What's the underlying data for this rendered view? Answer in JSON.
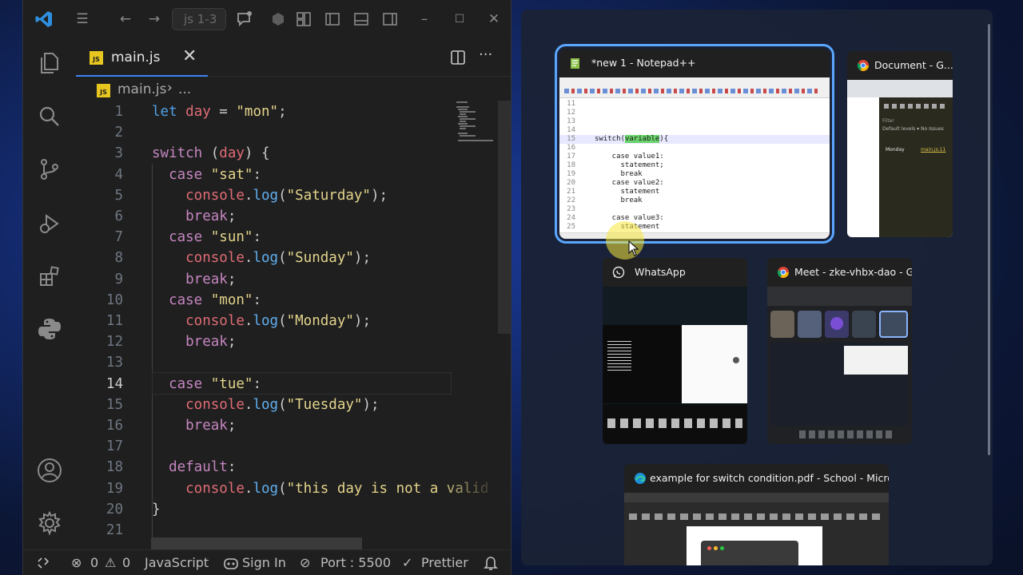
{
  "vscode": {
    "search_text": "js 1-3",
    "tab": {
      "label": "main.js",
      "badge": "JS"
    },
    "breadcrumb": {
      "file": "main.js",
      "more": "..."
    },
    "editor": {
      "active_line": 14,
      "lines": [
        {
          "n": "1",
          "tokens": [
            [
              "kw2",
              "let "
            ],
            [
              "var",
              "day"
            ],
            [
              "plain",
              " = "
            ],
            [
              "str",
              "\"mon\""
            ],
            [
              "plain",
              ";"
            ]
          ]
        },
        {
          "n": "2",
          "tokens": []
        },
        {
          "n": "3",
          "tokens": [
            [
              "kw",
              "switch"
            ],
            [
              "plain",
              " ("
            ],
            [
              "var",
              "day"
            ],
            [
              "plain",
              ") {"
            ]
          ]
        },
        {
          "n": "4",
          "tokens": [
            [
              "kw",
              "  case "
            ],
            [
              "str",
              "\"sat\""
            ],
            [
              "plain",
              ":"
            ]
          ]
        },
        {
          "n": "5",
          "tokens": [
            [
              "var",
              "    console"
            ],
            [
              "plain",
              "."
            ],
            [
              "fn",
              "log"
            ],
            [
              "plain",
              "("
            ],
            [
              "str",
              "\"Saturday\""
            ],
            [
              "plain",
              ");"
            ]
          ]
        },
        {
          "n": "6",
          "tokens": [
            [
              "kw",
              "    break"
            ],
            [
              "plain",
              ";"
            ]
          ]
        },
        {
          "n": "7",
          "tokens": [
            [
              "kw",
              "  case "
            ],
            [
              "str",
              "\"sun\""
            ],
            [
              "plain",
              ":"
            ]
          ]
        },
        {
          "n": "8",
          "tokens": [
            [
              "var",
              "    console"
            ],
            [
              "plain",
              "."
            ],
            [
              "fn",
              "log"
            ],
            [
              "plain",
              "("
            ],
            [
              "str",
              "\"Sunday\""
            ],
            [
              "plain",
              ");"
            ]
          ]
        },
        {
          "n": "9",
          "tokens": [
            [
              "kw",
              "    break"
            ],
            [
              "plain",
              ";"
            ]
          ]
        },
        {
          "n": "10",
          "tokens": [
            [
              "kw",
              "  case "
            ],
            [
              "str",
              "\"mon\""
            ],
            [
              "plain",
              ":"
            ]
          ]
        },
        {
          "n": "11",
          "tokens": [
            [
              "var",
              "    console"
            ],
            [
              "plain",
              "."
            ],
            [
              "fn",
              "log"
            ],
            [
              "plain",
              "("
            ],
            [
              "str",
              "\"Monday\""
            ],
            [
              "plain",
              ");"
            ]
          ]
        },
        {
          "n": "12",
          "tokens": [
            [
              "kw",
              "    break"
            ],
            [
              "plain",
              ";"
            ]
          ]
        },
        {
          "n": "13",
          "tokens": []
        },
        {
          "n": "14",
          "tokens": [
            [
              "kw",
              "  case "
            ],
            [
              "str",
              "\"tue\""
            ],
            [
              "plain",
              ":"
            ]
          ]
        },
        {
          "n": "15",
          "tokens": [
            [
              "var",
              "    console"
            ],
            [
              "plain",
              "."
            ],
            [
              "fn",
              "log"
            ],
            [
              "plain",
              "("
            ],
            [
              "str",
              "\"Tuesday\""
            ],
            [
              "plain",
              ");"
            ]
          ]
        },
        {
          "n": "16",
          "tokens": [
            [
              "kw",
              "    break"
            ],
            [
              "plain",
              ";"
            ]
          ]
        },
        {
          "n": "17",
          "tokens": []
        },
        {
          "n": "18",
          "tokens": [
            [
              "kw",
              "  default"
            ],
            [
              "plain",
              ":"
            ]
          ]
        },
        {
          "n": "19",
          "tokens": [
            [
              "var",
              "    console"
            ],
            [
              "plain",
              "."
            ],
            [
              "fn",
              "log"
            ],
            [
              "plain",
              "("
            ],
            [
              "str",
              "\"this day is not a valid"
            ]
          ]
        },
        {
          "n": "20",
          "tokens": [
            [
              "plain",
              "}"
            ]
          ]
        },
        {
          "n": "21",
          "tokens": []
        }
      ]
    },
    "status": {
      "errors": "0",
      "warnings": "0",
      "language": "JavaScript",
      "sign_in": "Sign In",
      "port": "Port : 5500",
      "formatter": "Prettier"
    }
  },
  "taskview": {
    "windows": [
      {
        "title": "*new 1 - Notepad++",
        "app": "notepad-plus-plus",
        "selected": true
      },
      {
        "title": "Document - G...",
        "app": "chrome"
      },
      {
        "title": "WhatsApp",
        "app": "whatsapp"
      },
      {
        "title": "Meet - zke-vhbx-dao - G...",
        "app": "chrome"
      },
      {
        "title": "example for switch condition.pdf - School - Microsoft...",
        "app": "edge"
      }
    ],
    "notepad_lines": [
      {
        "n": "11",
        "t": ""
      },
      {
        "n": "12",
        "t": ""
      },
      {
        "n": "13",
        "t": ""
      },
      {
        "n": "14",
        "t": ""
      },
      {
        "n": "15",
        "pre": "switch(",
        "hl": "variable",
        "post": "){"
      },
      {
        "n": "16",
        "t": ""
      },
      {
        "n": "17",
        "t": "    case value1:"
      },
      {
        "n": "18",
        "t": "      statement;"
      },
      {
        "n": "19",
        "t": "      break"
      },
      {
        "n": "20",
        "t": "    case value2:"
      },
      {
        "n": "21",
        "t": "      statement"
      },
      {
        "n": "22",
        "t": "      break"
      },
      {
        "n": "23",
        "t": ""
      },
      {
        "n": "24",
        "t": "    case value3:"
      },
      {
        "n": "25",
        "t": "      statement"
      }
    ],
    "chrome_devtools": {
      "filter": "Filter",
      "levels": "Default levels ▾",
      "issues": "No Issues",
      "log_value": "Monday",
      "log_src": "main.js:11"
    }
  }
}
